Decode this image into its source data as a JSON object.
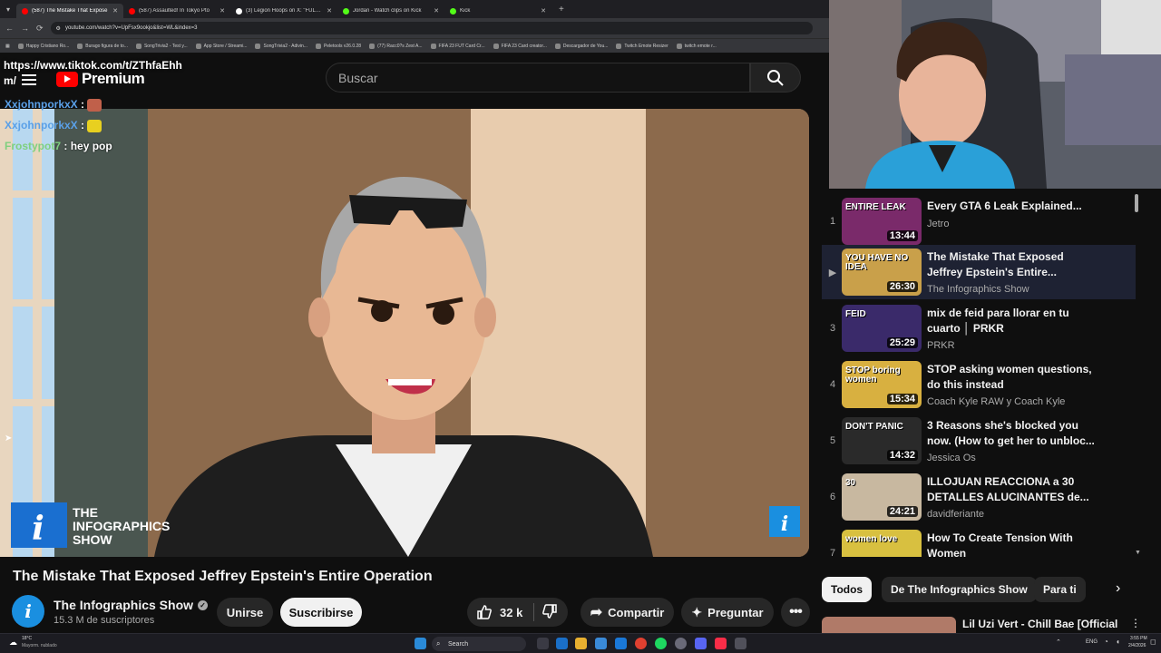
{
  "browser": {
    "tabs": [
      {
        "title": "(587) The Mistake That Expose",
        "active": true,
        "color": "#ff0000"
      },
      {
        "title": "(587) Assaulted! In Tokyo Pto",
        "active": false,
        "color": "#ff0000"
      },
      {
        "title": "(3) Legion Hoops on X: \"FULL T",
        "active": false,
        "color": "#ffffff"
      },
      {
        "title": "Jordan - Watch clips on Kick",
        "active": false,
        "color": "#53fc18"
      },
      {
        "title": "Kick",
        "active": false,
        "color": "#53fc18"
      }
    ],
    "url": "youtube.com/watch?v=UpFsx9ookjo&list=WL&index=3",
    "bookmarks": [
      "Happy Cristiano Ro...",
      "Burago figura de to...",
      "SongTrivia2 - Test y...",
      "App Store / Streami...",
      "SongTrivia2 - Adivin...",
      "Peletools v26.0.28",
      "(77) Racc0?s Zest A...",
      "FIFA 23 FUT Card Cr...",
      "FIFA 23 Card creator...",
      "Descargador de You...",
      "Twitch Emote Resizer",
      "twitch emote r..."
    ]
  },
  "overlay": {
    "tiktok_url": "https://www.tiktok.com/t/ZThfaEhh",
    "tiktok_url_suffix": "m/",
    "chat": [
      {
        "user": "XxjohnporkxX",
        "sep": ":",
        "message": "",
        "emote_color": "#c0604a"
      },
      {
        "user": "XxjohnporkxX",
        "sep": ":",
        "message": "",
        "emote_color": "#e8d020"
      },
      {
        "user": "Frostypot7",
        "sep": ":",
        "message": "hey pop",
        "emote_color": ""
      }
    ]
  },
  "header": {
    "brand": "Premium",
    "search_placeholder": "Buscar"
  },
  "video": {
    "title": "The Mistake That Exposed Jeffrey Epstein's Entire Operation",
    "watermark_line1": "THE",
    "watermark_line2": "INFOGRAPHICS",
    "watermark_line3": "SHOW",
    "channel": "The Infographics Show",
    "subscribers": "15.3 M de suscriptores",
    "join_label": "Unirse",
    "subscribe_label": "Suscribirse",
    "likes": "32 k",
    "share_label": "Compartir",
    "ask_label": "Preguntar"
  },
  "playlist": [
    {
      "num": "1",
      "title_l1": "Every GTA 6 Leak Explained...",
      "title_l2": "",
      "channel": "Jetro",
      "duration": "13:44",
      "thumb_text": "ENTIRE LEAK",
      "thumb_color": "#7a2a6a"
    },
    {
      "num": "▶",
      "title_l1": "The Mistake That Exposed",
      "title_l2": "Jeffrey Epstein's Entire...",
      "channel": "The Infographics Show",
      "duration": "26:30",
      "thumb_text": "YOU HAVE NO IDEA",
      "thumb_color": "#c9a04a"
    },
    {
      "num": "3",
      "title_l1": "mix de feid para llorar en tu",
      "title_l2": "cuarto │ PRKR",
      "channel": "PRKR",
      "duration": "25:29",
      "thumb_text": "FEID",
      "thumb_color": "#3a2a6a"
    },
    {
      "num": "4",
      "title_l1": "STOP asking women questions,",
      "title_l2": "do this instead",
      "channel": "Coach Kyle RAW y Coach Kyle",
      "duration": "15:34",
      "thumb_text": "STOP boring women",
      "thumb_color": "#d8b040"
    },
    {
      "num": "5",
      "title_l1": "3 Reasons she's blocked you",
      "title_l2": "now. (How to get her to unbloc...",
      "channel": "Jessica Os",
      "duration": "14:32",
      "thumb_text": "DON'T PANIC",
      "thumb_color": "#2a2a2a"
    },
    {
      "num": "6",
      "title_l1": "ILLOJUAN REACCIONA a 30",
      "title_l2": "DETALLES ALUCINANTES de...",
      "channel": "davidferiante",
      "duration": "24:21",
      "thumb_text": "30",
      "thumb_color": "#c8b8a0"
    },
    {
      "num": "7",
      "title_l1": "How To Create Tension With",
      "title_l2": "Women",
      "channel": "",
      "duration": "",
      "thumb_text": "women love",
      "thumb_color": "#d8c040"
    }
  ],
  "chips": [
    "Todos",
    "De The Infographics Show",
    "Para ti"
  ],
  "next_rec": "Lil Uzi Vert - Chill Bae [Official",
  "taskbar": {
    "weather_temp": "18°C",
    "weather_desc": "Mayorm. nublado",
    "search_label": "Search",
    "lang": "ENG",
    "time": "3:55 PM",
    "date": "2/4/2026"
  }
}
